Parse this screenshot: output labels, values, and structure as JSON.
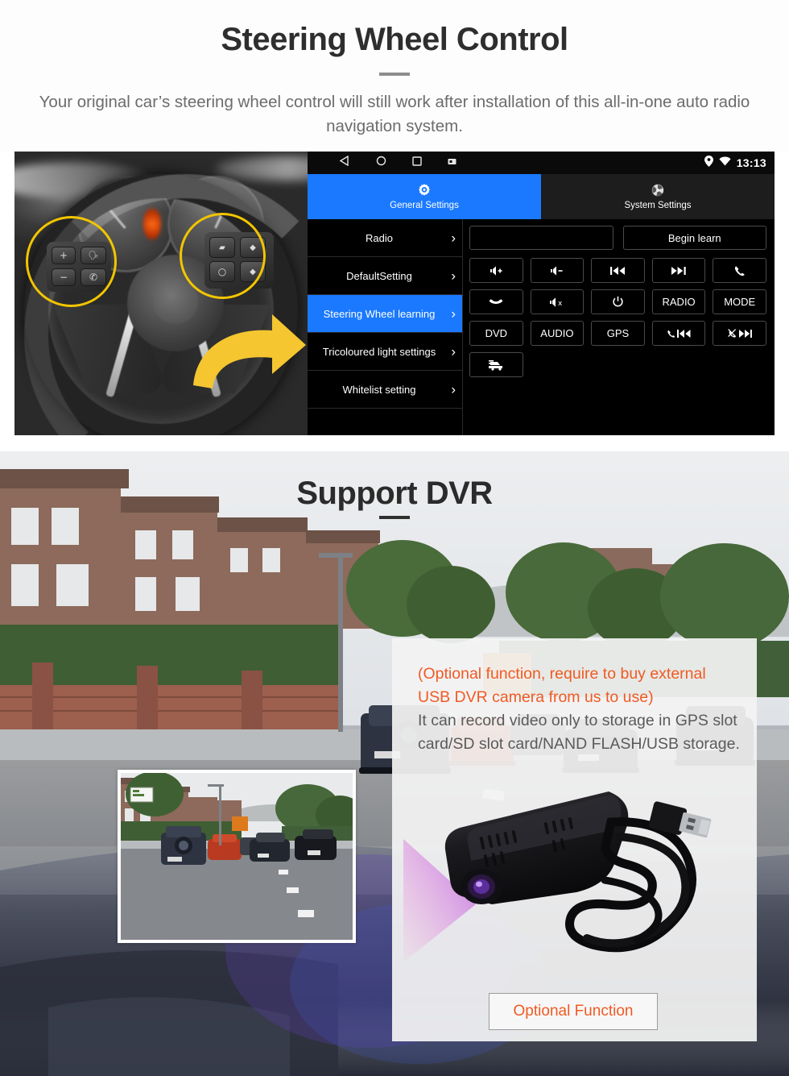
{
  "section1": {
    "title": "Steering Wheel Control",
    "subtitle": "Your original car’s steering wheel control will still work after installation of this all-in-one auto radio navigation system."
  },
  "headunit": {
    "statusbar": {
      "time": "13:13",
      "nav_back": "back-triangle",
      "nav_home": "home-circle",
      "nav_recents": "recents-square",
      "nav_screenshot": "screenshot-square",
      "location_icon": "location-pin-icon",
      "wifi_icon": "wifi-icon"
    },
    "tabs": [
      {
        "label": "General Settings",
        "icon": "gear-icon",
        "active": true
      },
      {
        "label": "System Settings",
        "icon": "system-icon",
        "active": false
      }
    ],
    "menu": [
      {
        "label": "Radio",
        "active": false
      },
      {
        "label": "DefaultSetting",
        "active": false
      },
      {
        "label": "Steering Wheel learning",
        "active": true
      },
      {
        "label": "Tricoloured light settings",
        "active": false
      },
      {
        "label": "Whitelist setting",
        "active": false
      }
    ],
    "learn": {
      "field_value": "",
      "button_label": "Begin learn"
    },
    "keys": [
      {
        "label": "",
        "icon": "volume-up-icon"
      },
      {
        "label": "",
        "icon": "volume-down-icon"
      },
      {
        "label": "",
        "icon": "previous-track-icon"
      },
      {
        "label": "",
        "icon": "next-track-icon"
      },
      {
        "label": "",
        "icon": "phone-answer-icon"
      },
      {
        "label": "",
        "icon": "phone-hangup-icon"
      },
      {
        "label": "",
        "icon": "mute-icon"
      },
      {
        "label": "",
        "icon": "power-icon"
      },
      {
        "label": "RADIO",
        "icon": ""
      },
      {
        "label": "MODE",
        "icon": ""
      },
      {
        "label": "DVD",
        "icon": ""
      },
      {
        "label": "AUDIO",
        "icon": ""
      },
      {
        "label": "GPS",
        "icon": ""
      },
      {
        "label": "",
        "icon": "phone-previous-icon"
      },
      {
        "label": "",
        "icon": "phone-reject-next-icon"
      },
      {
        "label": "",
        "icon": "car-icon"
      }
    ],
    "colors": {
      "accent": "#1a79ff",
      "background": "#000000",
      "border": "#4a4a4a"
    }
  },
  "section2": {
    "title": "Support DVR",
    "overlay": {
      "orange_text": "(Optional function, require to buy external USB DVR camera from us to use)",
      "grey_text": "It can record video only to storage in GPS slot card/SD slot card/NAND FLASH/USB storage.",
      "button_label": "Optional Function",
      "orange_color": "#f15a22"
    }
  }
}
